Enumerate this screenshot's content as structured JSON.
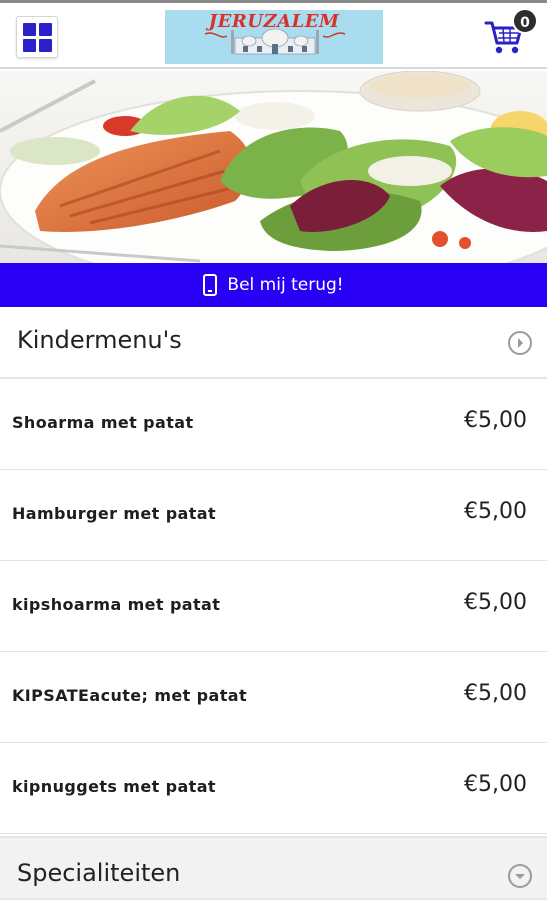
{
  "header": {
    "logo_title": "JERUZALEM",
    "logo_subtitle": "",
    "cart_count": "0"
  },
  "callbar": {
    "label": "Bel mij terug!"
  },
  "categories": [
    {
      "title": "Kindermenu's",
      "expanded": true,
      "items": [
        {
          "name": "Shoarma met patat",
          "price": "€5,00"
        },
        {
          "name": "Hamburger met patat",
          "price": "€5,00"
        },
        {
          "name": "kipshoarma met patat",
          "price": "€5,00"
        },
        {
          "name": "KIPSATEacute; met patat",
          "price": "€5,00"
        },
        {
          "name": "kipnuggets met patat",
          "price": "€5,00"
        }
      ]
    },
    {
      "title": "Specialiteiten",
      "expanded": false
    }
  ],
  "colors": {
    "accent": "#2a00f5",
    "menu_icon": "#2a22c8",
    "cart_icon": "#2a22c8"
  }
}
